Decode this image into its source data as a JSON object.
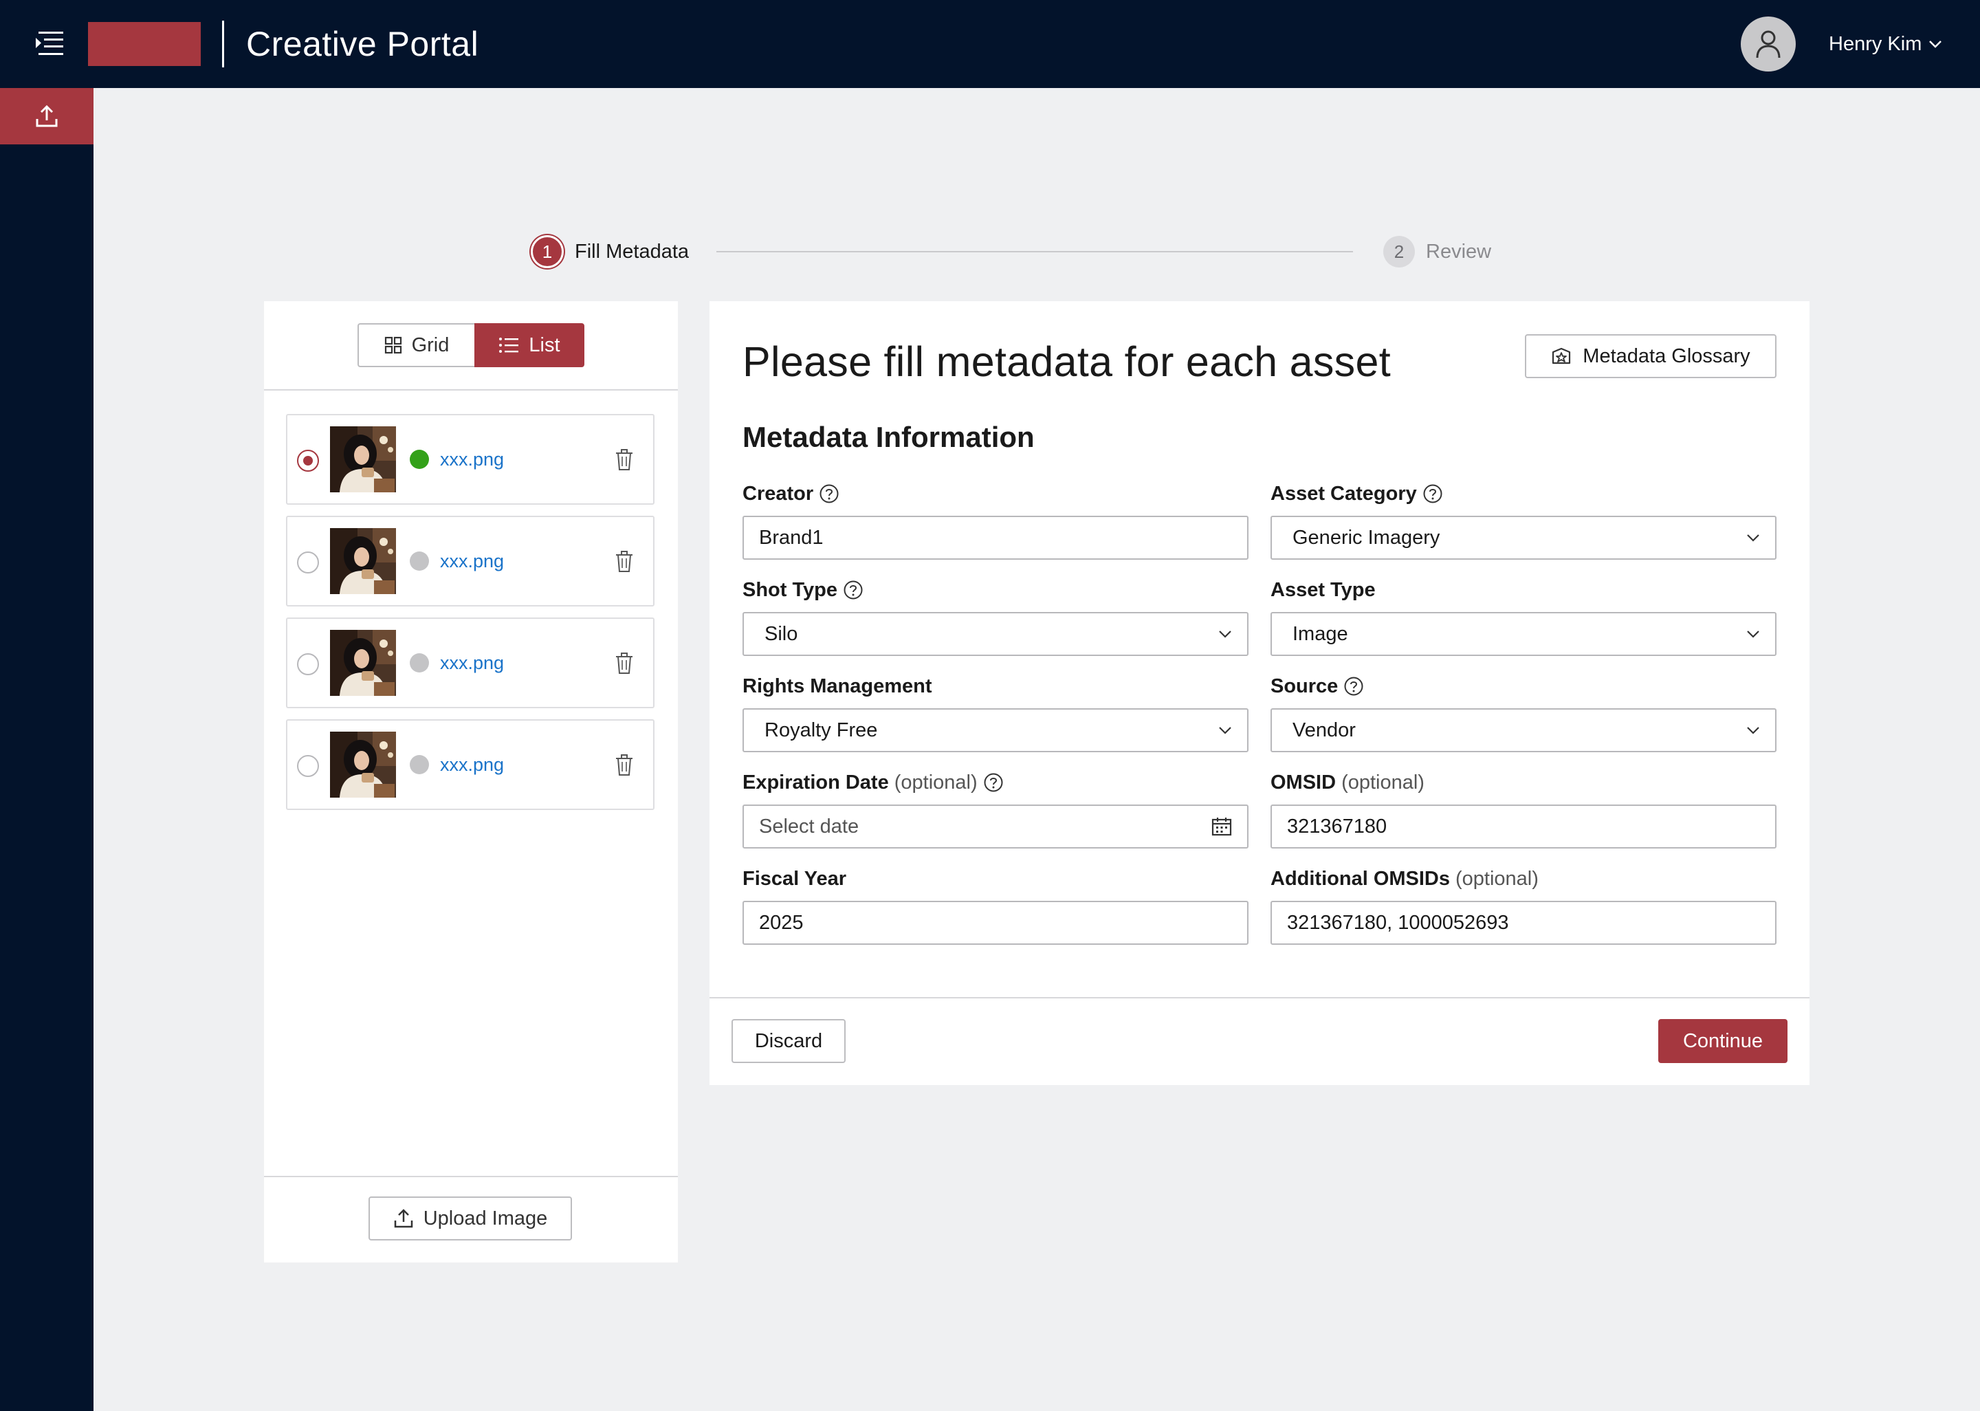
{
  "header": {
    "app_title": "Creative Portal",
    "user_name": "Henry Kim",
    "icons": {
      "menu": "menu-collapse-icon",
      "avatar": "user-icon",
      "dropdown": "chevron-down-icon"
    }
  },
  "sidebar": {
    "items": [
      {
        "icon": "upload-icon",
        "active": true
      }
    ]
  },
  "stepper": {
    "steps": [
      {
        "number": "1",
        "label": "Fill Metadata",
        "active": true
      },
      {
        "number": "2",
        "label": "Review",
        "active": false
      }
    ]
  },
  "asset_panel": {
    "view_toggle": {
      "grid_label": "Grid",
      "list_label": "List",
      "selected": "List"
    },
    "assets": [
      {
        "file_name": "xxx.png",
        "status_color": "#34A11A",
        "selected": true
      },
      {
        "file_name": "xxx.png",
        "status_color": "#C4C4C6",
        "selected": false
      },
      {
        "file_name": "xxx.png",
        "status_color": "#C4C4C6",
        "selected": false
      },
      {
        "file_name": "xxx.png",
        "status_color": "#C4C4C6",
        "selected": false
      }
    ],
    "upload_label": "Upload Image"
  },
  "form": {
    "title": "Please fill metadata for each asset",
    "glossary_label": "Metadata Glossary",
    "section_title": "Metadata Information",
    "creator": {
      "label": "Creator",
      "value": "Brand1"
    },
    "asset_category": {
      "label": "Asset Category",
      "value": "Generic Imagery"
    },
    "shot_type": {
      "label": "Shot Type",
      "value": "Silo"
    },
    "asset_type": {
      "label": "Asset Type",
      "value": "Image"
    },
    "rights_management": {
      "label": "Rights Management",
      "value": "Royalty Free"
    },
    "source": {
      "label": "Source",
      "value": "Vendor"
    },
    "expiration_date": {
      "label": "Expiration Date",
      "optional": "(optional)",
      "placeholder": "Select date"
    },
    "omsid": {
      "label": "OMSID",
      "optional": "(optional)",
      "value": "321367180"
    },
    "fiscal_year": {
      "label": "Fiscal Year",
      "value": "2025"
    },
    "additional_omsids": {
      "label": "Additional OMSIDs",
      "optional": "(optional)",
      "value": "321367180, 1000052693"
    },
    "discard_label": "Discard",
    "continue_label": "Continue"
  },
  "colors": {
    "brand": "#A5373F",
    "navy": "#03132B",
    "link": "#1A73C9",
    "background": "#EFF0F2"
  }
}
